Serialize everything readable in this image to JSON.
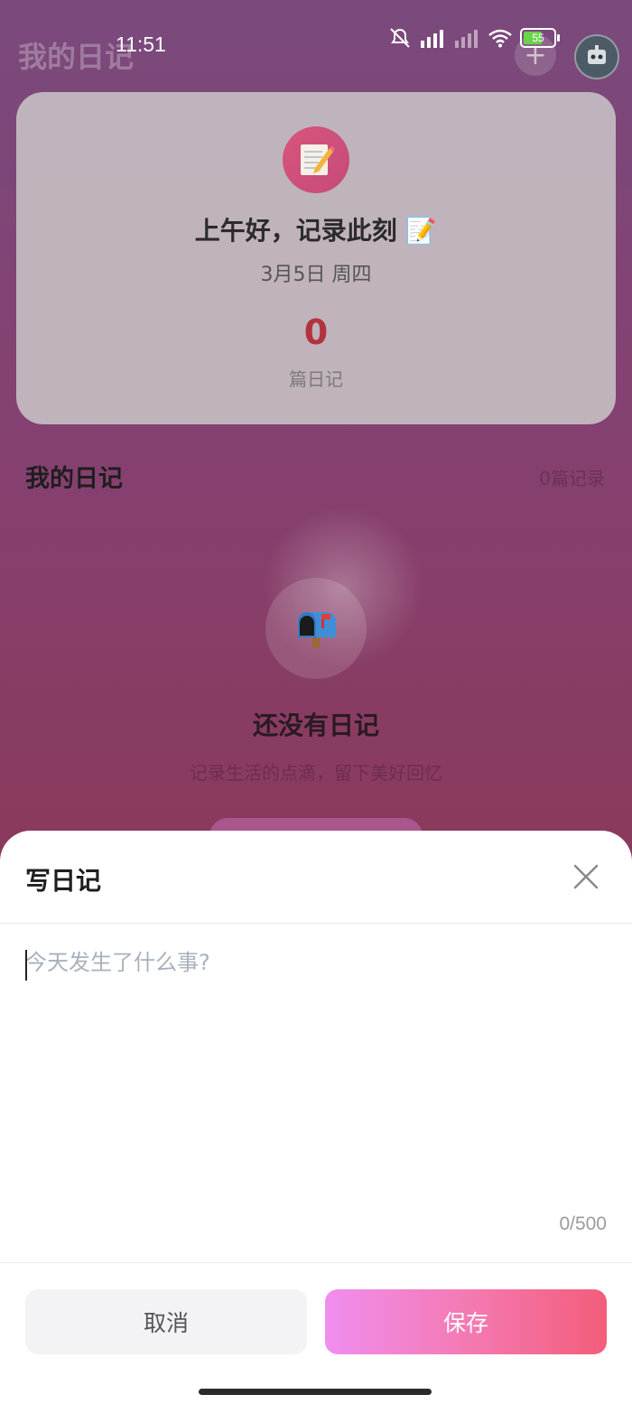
{
  "status_bar": {
    "time": "11:51",
    "battery": "55"
  },
  "header": {
    "title": "我的日记",
    "add_icon": "plus-icon",
    "avatar_icon": "robot-avatar-icon"
  },
  "greeting_card": {
    "icon": "memo-icon",
    "greeting": "上午好，记录此刻 📝",
    "date": "3月5日 周四",
    "count": "0",
    "count_label": "篇日记"
  },
  "diary_section": {
    "title": "我的日记",
    "count_text": "0篇记录",
    "empty_icon": "mailbox-icon",
    "empty_title": "还没有日记",
    "empty_subtitle": "记录生活的点滴，留下美好回忆"
  },
  "sheet": {
    "title": "写日记",
    "close_icon": "close-icon",
    "placeholder": "今天发生了什么事?",
    "char_count": "0/500",
    "cancel_label": "取消",
    "save_label": "保存"
  },
  "colors": {
    "count_color": "#b3323f",
    "save_gradient_start": "#f08ef0",
    "save_gradient_end": "#f35d7a"
  }
}
